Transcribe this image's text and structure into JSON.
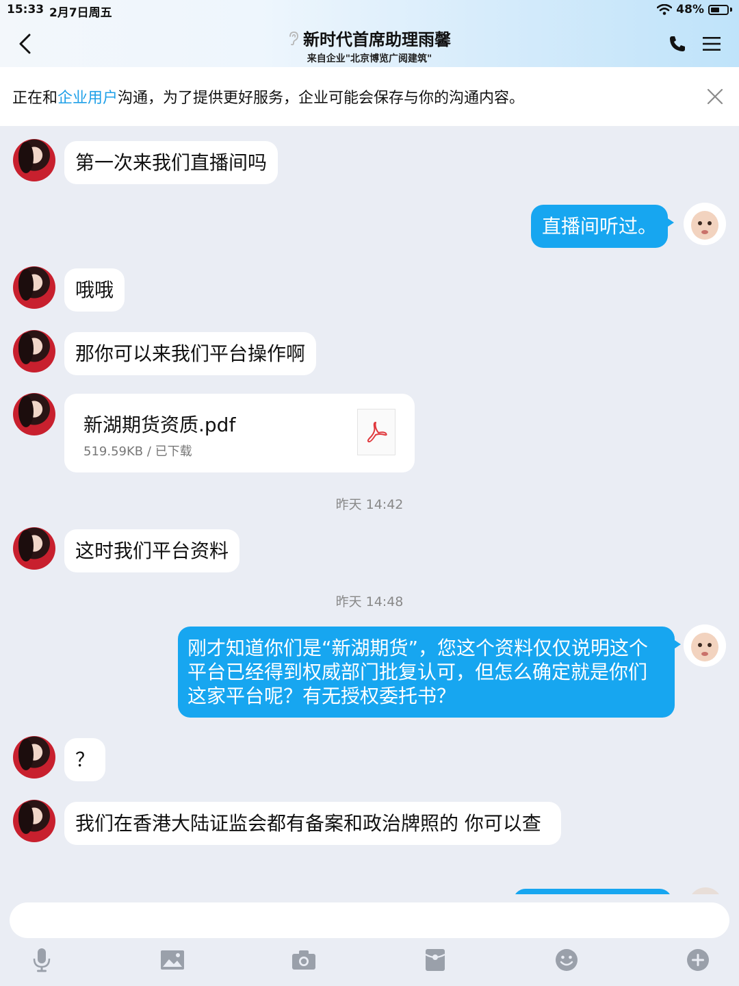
{
  "status_bar": {
    "time": "15:33",
    "date": "2月7日周五",
    "battery": "48%"
  },
  "header": {
    "title": "新时代首席助理雨馨",
    "subtitle": "来自企业\"北京博览广阅建筑\""
  },
  "notice": {
    "prefix": "正在和",
    "highlight": "企业用户",
    "suffix": "沟通，为了提供更好服务，企业可能会保存与你的沟通内容。"
  },
  "messages": {
    "m1": "第一次来我们直播间吗",
    "m2": "直播间听过。",
    "m3": "哦哦",
    "m4": "那你可以来我们平台操作啊",
    "file_name": "新湖期货资质.pdf",
    "file_meta": "519.59KB / 已下载",
    "ts1": "昨天 14:42",
    "m5": "这时我们平台资料",
    "ts2": "昨天 14:48",
    "m6": "刚才知道你们是“新湖期货”，您这个资料仅仅说明这个平台已经得到权威部门批复认可，但怎么确定就是你们这家平台呢？有无授权委托书？",
    "m7": "？",
    "m8": "我们在香港大陆证监会都有备案和政治牌照的 你可以查"
  },
  "colors": {
    "accent": "#17a6f0",
    "highlight": "#1ea0e8",
    "background": "#eaedf4"
  },
  "icons": [
    "back-icon",
    "ear-icon",
    "phone-icon",
    "menu-icon",
    "close-icon",
    "pdf-icon",
    "microphone-icon",
    "image-icon",
    "camera-icon",
    "red-packet-icon",
    "emoji-icon",
    "plus-icon"
  ]
}
